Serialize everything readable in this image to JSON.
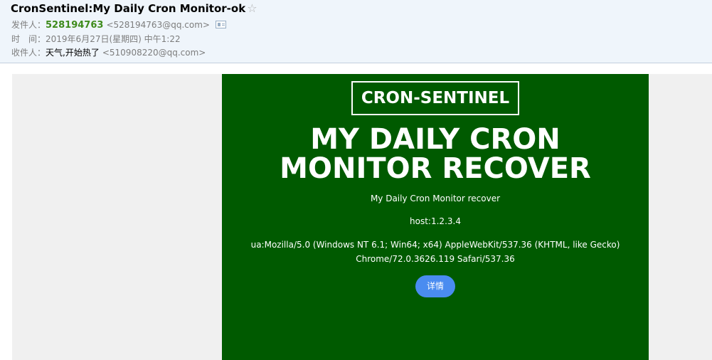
{
  "mail": {
    "subject": "CronSentinel:My Daily Cron Monitor-ok",
    "star_glyph": "☆",
    "from_label": "发件人：",
    "sender_name": "528194763",
    "sender_addr": "<528194763@qq.com>",
    "card_icon": "contact-card-icon",
    "time_label": "时　间：",
    "time_value": "2019年6月27日(星期四) 中午1:22",
    "to_label": "收件人：",
    "recipient_name": "天气,开始热了",
    "recipient_addr": "<510908220@qq.com>"
  },
  "content": {
    "brand": "CRON-SENTINEL",
    "headline_line1": "MY DAILY CRON",
    "headline_line2": "MONITOR RECOVER",
    "description": "My Daily Cron Monitor recover",
    "host": "host:1.2.3.4",
    "ua": "ua:Mozilla/5.0 (Windows NT 6.1; Win64; x64) AppleWebKit/537.36 (KHTML, like Gecko) Chrome/72.0.3626.119 Safari/537.36",
    "detail_button": "详情"
  },
  "colors": {
    "panel_bg": "#005a00",
    "sender_green": "#3e8b1c",
    "button_blue": "#4a8cf0",
    "header_bg": "#eff5fb"
  }
}
